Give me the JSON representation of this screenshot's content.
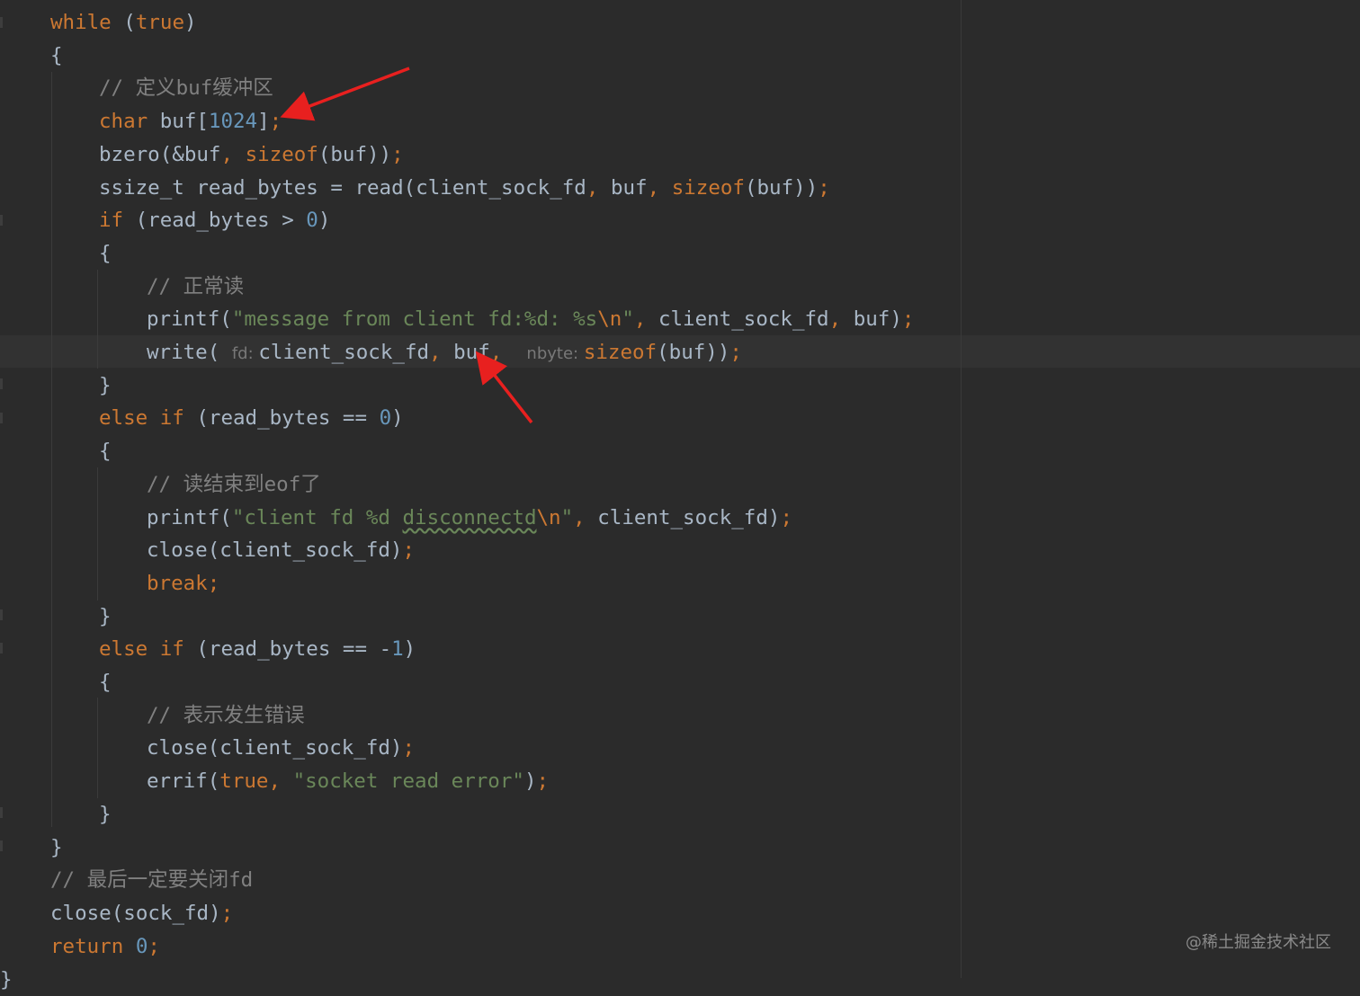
{
  "code": {
    "lines": [
      {
        "indent": 56,
        "tokens": [
          {
            "t": "while",
            "c": "kw"
          },
          {
            "t": " (",
            "c": "id"
          },
          {
            "t": "true",
            "c": "kw"
          },
          {
            "t": ")",
            "c": "id"
          }
        ]
      },
      {
        "indent": 56,
        "tokens": [
          {
            "t": "{",
            "c": "id"
          }
        ]
      },
      {
        "indent": 110,
        "tokens": [
          {
            "t": "// 定义buf缓冲区",
            "c": "cmt"
          }
        ]
      },
      {
        "indent": 110,
        "tokens": [
          {
            "t": "char",
            "c": "kw"
          },
          {
            "t": " buf[",
            "c": "id"
          },
          {
            "t": "1024",
            "c": "num"
          },
          {
            "t": "]",
            "c": "id"
          },
          {
            "t": ";",
            "c": "punct"
          }
        ]
      },
      {
        "indent": 110,
        "tokens": [
          {
            "t": "bzero(&buf",
            "c": "id"
          },
          {
            "t": ", ",
            "c": "punct"
          },
          {
            "t": "sizeof",
            "c": "kw"
          },
          {
            "t": "(buf))",
            "c": "id"
          },
          {
            "t": ";",
            "c": "punct"
          }
        ]
      },
      {
        "indent": 110,
        "tokens": [
          {
            "t": "ssize_t read_bytes = read(client_sock_fd",
            "c": "id"
          },
          {
            "t": ", ",
            "c": "punct"
          },
          {
            "t": "buf",
            "c": "id"
          },
          {
            "t": ", ",
            "c": "punct"
          },
          {
            "t": "sizeof",
            "c": "kw"
          },
          {
            "t": "(buf))",
            "c": "id"
          },
          {
            "t": ";",
            "c": "punct"
          }
        ]
      },
      {
        "indent": 110,
        "tokens": [
          {
            "t": "if",
            "c": "kw"
          },
          {
            "t": " (read_bytes > ",
            "c": "id"
          },
          {
            "t": "0",
            "c": "num"
          },
          {
            "t": ")",
            "c": "id"
          }
        ]
      },
      {
        "indent": 110,
        "tokens": [
          {
            "t": "{",
            "c": "id"
          }
        ]
      },
      {
        "indent": 163,
        "tokens": [
          {
            "t": "// 正常读",
            "c": "cmt"
          }
        ]
      },
      {
        "indent": 163,
        "tokens": [
          {
            "t": "printf(",
            "c": "id"
          },
          {
            "t": "\"message from client fd:%d: %s",
            "c": "str"
          },
          {
            "t": "\\n",
            "c": "esc"
          },
          {
            "t": "\"",
            "c": "str"
          },
          {
            "t": ", ",
            "c": "punct"
          },
          {
            "t": "client_sock_fd",
            "c": "id"
          },
          {
            "t": ", ",
            "c": "punct"
          },
          {
            "t": "buf)",
            "c": "id"
          },
          {
            "t": ";",
            "c": "punct"
          }
        ]
      },
      {
        "indent": 163,
        "tokens": [
          {
            "t": "write( ",
            "c": "id"
          },
          {
            "t": "fd: ",
            "c": "hint"
          },
          {
            "t": "client_sock_fd",
            "c": "id"
          },
          {
            "t": ", ",
            "c": "punct"
          },
          {
            "t": "buf",
            "c": "id"
          },
          {
            "t": ",  ",
            "c": "punct"
          },
          {
            "t": "nbyte: ",
            "c": "hint"
          },
          {
            "t": "sizeof",
            "c": "kw"
          },
          {
            "t": "(buf))",
            "c": "id"
          },
          {
            "t": ";",
            "c": "punct"
          }
        ]
      },
      {
        "indent": 110,
        "tokens": [
          {
            "t": "}",
            "c": "id"
          }
        ]
      },
      {
        "indent": 110,
        "tokens": [
          {
            "t": "else if",
            "c": "kw"
          },
          {
            "t": " (read_bytes == ",
            "c": "id"
          },
          {
            "t": "0",
            "c": "num"
          },
          {
            "t": ")",
            "c": "id"
          }
        ]
      },
      {
        "indent": 110,
        "tokens": [
          {
            "t": "{",
            "c": "id"
          }
        ]
      },
      {
        "indent": 163,
        "tokens": [
          {
            "t": "// 读结束到eof了",
            "c": "cmt"
          }
        ]
      },
      {
        "indent": 163,
        "tokens": [
          {
            "t": "printf(",
            "c": "id"
          },
          {
            "t": "\"client fd %d ",
            "c": "str"
          },
          {
            "t": "disconnectd",
            "c": "typo"
          },
          {
            "t": "\\n",
            "c": "esc"
          },
          {
            "t": "\"",
            "c": "str"
          },
          {
            "t": ", ",
            "c": "punct"
          },
          {
            "t": "client_sock_fd)",
            "c": "id"
          },
          {
            "t": ";",
            "c": "punct"
          }
        ]
      },
      {
        "indent": 163,
        "tokens": [
          {
            "t": "close(client_sock_fd)",
            "c": "id"
          },
          {
            "t": ";",
            "c": "punct"
          }
        ]
      },
      {
        "indent": 163,
        "tokens": [
          {
            "t": "break",
            "c": "kw"
          },
          {
            "t": ";",
            "c": "punct"
          }
        ]
      },
      {
        "indent": 110,
        "tokens": [
          {
            "t": "}",
            "c": "id"
          }
        ]
      },
      {
        "indent": 110,
        "tokens": [
          {
            "t": "else if",
            "c": "kw"
          },
          {
            "t": " (read_bytes == -",
            "c": "id"
          },
          {
            "t": "1",
            "c": "num"
          },
          {
            "t": ")",
            "c": "id"
          }
        ]
      },
      {
        "indent": 110,
        "tokens": [
          {
            "t": "{",
            "c": "id"
          }
        ]
      },
      {
        "indent": 163,
        "tokens": [
          {
            "t": "// 表示发生错误",
            "c": "cmt"
          }
        ]
      },
      {
        "indent": 163,
        "tokens": [
          {
            "t": "close(client_sock_fd)",
            "c": "id"
          },
          {
            "t": ";",
            "c": "punct"
          }
        ]
      },
      {
        "indent": 163,
        "tokens": [
          {
            "t": "errif(",
            "c": "id"
          },
          {
            "t": "true",
            "c": "kw"
          },
          {
            "t": ", ",
            "c": "punct"
          },
          {
            "t": "\"socket read error\"",
            "c": "str"
          },
          {
            "t": ")",
            "c": "id"
          },
          {
            "t": ";",
            "c": "punct"
          }
        ]
      },
      {
        "indent": 110,
        "tokens": [
          {
            "t": "}",
            "c": "id"
          }
        ]
      },
      {
        "indent": 56,
        "tokens": [
          {
            "t": "}",
            "c": "id"
          }
        ]
      },
      {
        "indent": 56,
        "tokens": [
          {
            "t": "// 最后一定要关闭fd",
            "c": "cmt"
          }
        ]
      },
      {
        "indent": 56,
        "tokens": [
          {
            "t": "close(sock_fd)",
            "c": "id"
          },
          {
            "t": ";",
            "c": "punct"
          }
        ]
      },
      {
        "indent": 56,
        "tokens": [
          {
            "t": "return ",
            "c": "kw"
          },
          {
            "t": "0",
            "c": "num"
          },
          {
            "t": ";",
            "c": "punct"
          }
        ]
      }
    ],
    "trailing_brace": "}"
  },
  "watermark": "@稀土掘金技术社区",
  "colors": {
    "background": "#2b2b2b",
    "keyword": "#cc7832",
    "identifier": "#a9b7c6",
    "number": "#6897bb",
    "string": "#6a8759",
    "comment": "#808080",
    "annotation_arrow": "#e8201f"
  }
}
